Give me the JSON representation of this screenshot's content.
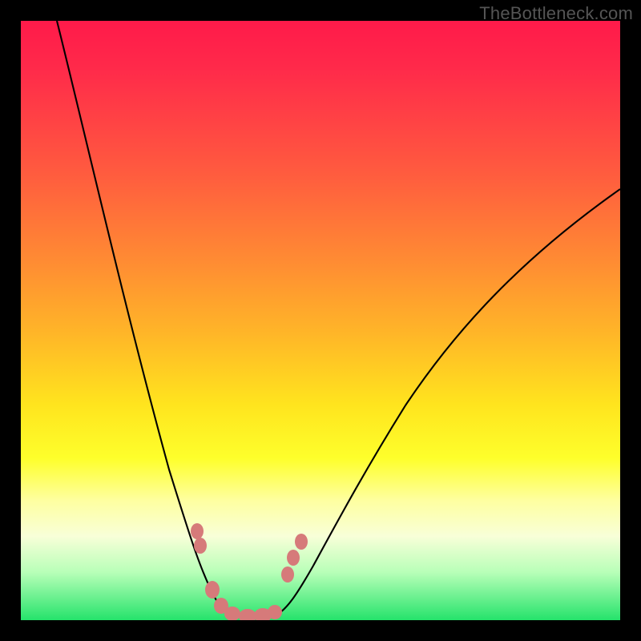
{
  "watermark": "TheBottleneck.com",
  "colors": {
    "frame": "#000000",
    "gradient_top": "#ff1a4a",
    "gradient_bottom": "#25e36b",
    "curve": "#000000",
    "marker": "#d67a7a"
  },
  "chart_data": {
    "type": "line",
    "title": "",
    "xlabel": "",
    "ylabel": "",
    "xlim": [
      0,
      100
    ],
    "ylim": [
      0,
      100
    ],
    "grid": false,
    "legend": false,
    "notes": "V-shaped bottleneck curve on rainbow gradient background. Lower y (green) = better match; higher y (red) = stronger bottleneck. Left branch starts near top-left, descends steeply to a flat minimum around x 33-42, then right branch rises more gently toward top-right. Pink markers cluster near the trough on both sides plus a short flat run along the minimum.",
    "series": [
      {
        "name": "bottleneck_curve",
        "x": [
          6,
          10,
          15,
          20,
          25,
          30,
          33,
          38,
          42,
          45,
          50,
          55,
          60,
          65,
          75,
          85,
          95,
          100
        ],
        "y": [
          100,
          78,
          60,
          45,
          30,
          12,
          3,
          2,
          2,
          5,
          12,
          22,
          32,
          40,
          52,
          62,
          70,
          72
        ]
      }
    ],
    "markers": [
      {
        "x": 29,
        "y": 15
      },
      {
        "x": 29.5,
        "y": 12
      },
      {
        "x": 31.5,
        "y": 5
      },
      {
        "x": 33,
        "y": 2.5
      },
      {
        "x": 36,
        "y": 2
      },
      {
        "x": 39,
        "y": 2
      },
      {
        "x": 41.5,
        "y": 2.5
      },
      {
        "x": 44,
        "y": 9
      },
      {
        "x": 45,
        "y": 12
      },
      {
        "x": 46.5,
        "y": 14
      }
    ]
  }
}
